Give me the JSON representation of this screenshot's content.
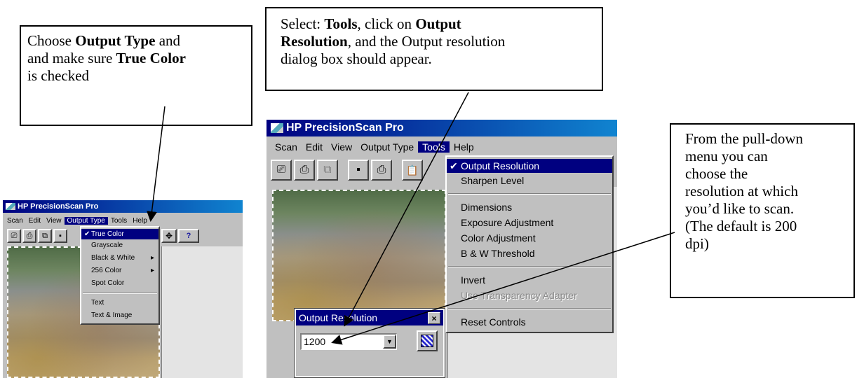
{
  "callouts": {
    "left": {
      "line1_pre": "Choose ",
      "line1_bold": "Output Type",
      "line1_post": " and",
      "line2_pre": "and make sure ",
      "line2_bold": "True Color",
      "line3": "is checked"
    },
    "top": {
      "line1_pre": "Select: ",
      "line1_bold1": "Tools",
      "line1_mid": ", click on ",
      "line1_bold2": "Output",
      "line2_bold": "Resolution",
      "line2_post": ", and the Output resolution",
      "line3": "dialog box should appear."
    },
    "right": {
      "lines": [
        "From the pull-down",
        "menu you can",
        "choose the",
        "resolution at which",
        "you’d like to scan.",
        "(The default is 200",
        "dpi)"
      ]
    }
  },
  "left_window": {
    "title": "HP PrecisionScan Pro",
    "menus": [
      "Scan",
      "Edit",
      "View",
      "Output Type",
      "Tools",
      "Help"
    ],
    "output_type_menu": [
      {
        "label": "True Color",
        "checked": true,
        "selected": true
      },
      {
        "label": "Grayscale"
      },
      {
        "label": "Black & White",
        "submenu": true
      },
      {
        "label": "256 Color",
        "submenu": true
      },
      {
        "label": "Spot Color"
      },
      {
        "label": "Text"
      },
      {
        "label": "Text & Image"
      }
    ]
  },
  "right_window": {
    "title": "HP PrecisionScan Pro",
    "menus": [
      "Scan",
      "Edit",
      "View",
      "Output Type",
      "Tools",
      "Help"
    ],
    "tools_menu": {
      "output_resolution": "Output Resolution",
      "sharpen_level": "Sharpen Level",
      "dimensions": "Dimensions",
      "exposure_adjustment": "Exposure Adjustment",
      "color_adjustment": "Color Adjustment",
      "bw_threshold": "B & W Threshold",
      "invert": "Invert",
      "use_transparency_adapter": "Use Transparency Adapter",
      "reset_controls": "Reset Controls"
    },
    "dialog": {
      "title": "Output Resolution",
      "close_glyph": "×",
      "value": "1200"
    }
  },
  "icons": {
    "check": "✔",
    "submenu_arrow": "▸",
    "dropdown_arrow": "▼",
    "help_glyph": "?"
  },
  "colors": {
    "title_bar": "#000080",
    "menu_highlight": "#000080",
    "window_face": "#c0c0c0"
  }
}
